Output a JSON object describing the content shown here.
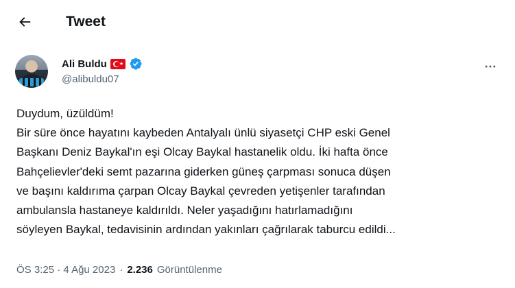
{
  "header": {
    "title": "Tweet"
  },
  "author": {
    "display_name": "Ali Buldu",
    "handle": "@alibuldu07",
    "icons": [
      "turkey-flag-icon",
      "verified-badge-icon"
    ],
    "verified_color": "#1d9bf0"
  },
  "tweet": {
    "lines": [
      "Duydum, üzüldüm!",
      "Bir süre önce hayatını kaybeden Antalyalı ünlü siyasetçi CHP eski Genel",
      "Başkanı Deniz Baykal'ın eşi Olcay Baykal hastanelik oldu. İki hafta önce",
      "Bahçelievler'deki semt pazarına giderken güneş çarpması sonuca düşen",
      "ve başını kaldırıma çarpan Olcay Baykal çevreden yetişenler tarafından",
      "ambulansla hastaneye kaldırıldı. Neler yaşadığını hatırlamadığını",
      "söyleyen Baykal, tedavisinin ardından yakınları çağrılarak taburcu edildi..."
    ]
  },
  "meta": {
    "time": "ÖS 3:25",
    "separator": "·",
    "date": "4 Ağu 2023",
    "views_count": "2.236",
    "views_label": "Görüntülenme"
  },
  "colors": {
    "text_primary": "#0f1419",
    "text_secondary": "#536471",
    "accent": "#1d9bf0",
    "flag_red": "#e30a17"
  }
}
